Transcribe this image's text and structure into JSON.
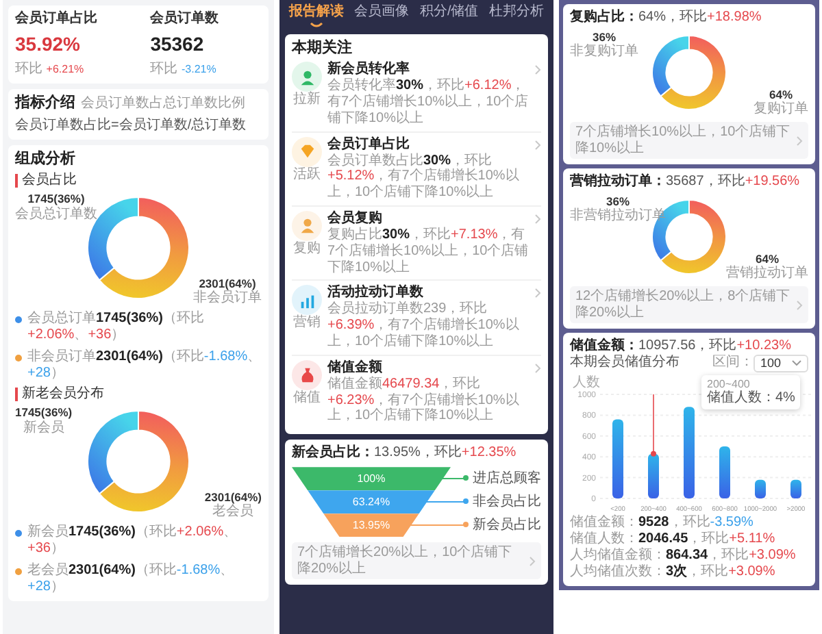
{
  "member_panel": {
    "metrics": [
      {
        "label": "会员订单占比",
        "value": "35.92%",
        "highlight": true,
        "trend_label": "环比",
        "change": {
          "text": "+6.21%",
          "kind": "up"
        }
      },
      {
        "label": "会员订单数",
        "value": "35362",
        "highlight": false,
        "trend_label": "环比",
        "change": {
          "text": "-3.21%",
          "kind": "down"
        }
      }
    ],
    "intro": {
      "title": "指标介绍",
      "subtitle": "会员订单数占总订单数比例",
      "formula": "会员订单数占比=会员订单数/总订单数"
    },
    "composition": {
      "title": "组成分析",
      "sections": [
        {
          "title": "会员占比",
          "chart_data": {
            "type": "donut",
            "categories": [
              "会员总订单数",
              "非会员订单"
            ],
            "values": [
              36,
              64
            ],
            "value_labels": [
              "1745(36%)",
              "2301(64%)"
            ]
          },
          "legend": [
            {
              "color": "#3d8fe8",
              "segments": [
                {
                  "text": "会员总订单",
                  "kind": "muted"
                },
                {
                  "text": "1745(36%)",
                  "kind": "bold"
                },
                {
                  "text": "（环比",
                  "kind": "muted"
                },
                {
                  "text": "+2.06%",
                  "kind": "up"
                },
                {
                  "text": "、",
                  "kind": "muted"
                },
                {
                  "text": "+36",
                  "kind": "up"
                },
                {
                  "text": "）",
                  "kind": "muted"
                }
              ]
            },
            {
              "color": "#f0a040",
              "segments": [
                {
                  "text": "非会员订单",
                  "kind": "muted"
                },
                {
                  "text": "2301(64%)",
                  "kind": "bold"
                },
                {
                  "text": "（环比",
                  "kind": "muted"
                },
                {
                  "text": "-1.68%",
                  "kind": "down"
                },
                {
                  "text": "、",
                  "kind": "muted"
                },
                {
                  "text": "+28",
                  "kind": "down"
                },
                {
                  "text": "）",
                  "kind": "muted"
                }
              ]
            }
          ]
        },
        {
          "title": "新老会员分布",
          "chart_data": {
            "type": "donut",
            "categories": [
              "新会员",
              "老会员"
            ],
            "values": [
              36,
              64
            ],
            "value_labels": [
              "1745(36%)",
              "2301(64%)"
            ]
          },
          "legend": [
            {
              "color": "#3d8fe8",
              "segments": [
                {
                  "text": "新会员",
                  "kind": "muted"
                },
                {
                  "text": "1745(36%)",
                  "kind": "bold"
                },
                {
                  "text": "（环比",
                  "kind": "muted"
                },
                {
                  "text": "+2.06%",
                  "kind": "up"
                },
                {
                  "text": "、",
                  "kind": "muted"
                },
                {
                  "text": "+36",
                  "kind": "up"
                },
                {
                  "text": "）",
                  "kind": "muted"
                }
              ]
            },
            {
              "color": "#f0a040",
              "segments": [
                {
                  "text": "老会员",
                  "kind": "muted"
                },
                {
                  "text": "2301(64%)",
                  "kind": "bold"
                },
                {
                  "text": "（环比",
                  "kind": "muted"
                },
                {
                  "text": "-1.68%",
                  "kind": "down"
                },
                {
                  "text": "、",
                  "kind": "muted"
                },
                {
                  "text": "+28",
                  "kind": "down"
                },
                {
                  "text": "）",
                  "kind": "muted"
                }
              ]
            }
          ]
        }
      ]
    }
  },
  "report_panel": {
    "tabs": [
      {
        "label": "报告解读",
        "selected": true
      },
      {
        "label": "会员画像",
        "selected": false
      },
      {
        "label": "积分/储值",
        "selected": false
      },
      {
        "label": "杜邦分析",
        "selected": false
      }
    ],
    "focus": {
      "title": "本期关注",
      "items": [
        {
          "icon_label": "拉新",
          "color": "#2fb866",
          "title": "新会员转化率",
          "segments": [
            {
              "text": "会员转化率",
              "kind": "muted"
            },
            {
              "text": "30%",
              "kind": "bold"
            },
            {
              "text": "，环比",
              "kind": "muted"
            },
            {
              "text": "+6.12%",
              "kind": "up"
            },
            {
              "text": "，有7个店铺增长10%以上，10个店铺下降10%以上",
              "kind": "muted"
            }
          ]
        },
        {
          "icon_label": "活跃",
          "color": "#f5a524",
          "title": "会员订单占比",
          "segments": [
            {
              "text": "会员订单数占比",
              "kind": "muted"
            },
            {
              "text": "30%",
              "kind": "bold"
            },
            {
              "text": "，环比",
              "kind": "muted"
            },
            {
              "text": "+5.12%",
              "kind": "up"
            },
            {
              "text": "，有7个店铺增长10%以上，10个店铺下降10%以上",
              "kind": "muted"
            }
          ]
        },
        {
          "icon_label": "复购",
          "color": "#f0a848",
          "title": "会员复购",
          "segments": [
            {
              "text": "复购占比",
              "kind": "muted"
            },
            {
              "text": "30%",
              "kind": "bold"
            },
            {
              "text": "，环比",
              "kind": "muted"
            },
            {
              "text": "+7.13%",
              "kind": "up"
            },
            {
              "text": "，有7个店铺增长10%以上，10个店铺下降10%以上",
              "kind": "muted"
            }
          ]
        },
        {
          "icon_label": "营销",
          "color": "#22a8e0",
          "title": "活动拉动订单数",
          "segments": [
            {
              "text": "会员拉动订单数239，环比",
              "kind": "muted"
            },
            {
              "text": "+6.39%",
              "kind": "up"
            },
            {
              "text": "，有7个店铺增长10%以上，10个店铺下降10%以上",
              "kind": "muted"
            }
          ]
        },
        {
          "icon_label": "储值",
          "color": "#e84848",
          "title": "储值金额",
          "segments": [
            {
              "text": "储值金额",
              "kind": "muted"
            },
            {
              "text": "46479.34",
              "kind": "up"
            },
            {
              "text": "，环比",
              "kind": "muted"
            },
            {
              "text": "+6.23%",
              "kind": "up"
            },
            {
              "text": "，有7个店铺增长10%以上，10个店铺下降10%以上",
              "kind": "muted"
            }
          ]
        }
      ]
    },
    "funnel_card": {
      "title": [
        {
          "text": "新会员占比：",
          "kind": "bold"
        },
        {
          "text": "13.95%，环比",
          "kind": "plain"
        },
        {
          "text": "+12.35%",
          "kind": "up"
        }
      ],
      "stages": [
        {
          "value": "100%",
          "label": "进店总顾客",
          "color": "#3cb96a"
        },
        {
          "value": "63.24%",
          "label": "非会员占比",
          "color": "#3ea6ee"
        },
        {
          "value": "13.95%",
          "label": "新会员占比",
          "color": "#f7a25c"
        }
      ],
      "footer": "7个店铺增长20%以上，10个店铺下降20%以上"
    }
  },
  "detail_panel": {
    "donut_cards": [
      {
        "title": [
          {
            "text": "复购占比：",
            "kind": "bold"
          },
          {
            "text": "64%，环比",
            "kind": "plain"
          },
          {
            "text": "+18.98%",
            "kind": "up"
          }
        ],
        "chart_data": {
          "type": "donut",
          "categories": [
            "非复购订单",
            "复购订单"
          ],
          "values": [
            36,
            64
          ],
          "value_labels": [
            "36%",
            "64%"
          ]
        },
        "footer": "7个店铺增长10%以上，10个店铺下降10%以上"
      },
      {
        "title": [
          {
            "text": "营销拉动订单：",
            "kind": "bold"
          },
          {
            "text": "35687，环比",
            "kind": "plain"
          },
          {
            "text": "+19.56%",
            "kind": "up"
          }
        ],
        "chart_data": {
          "type": "donut",
          "categories": [
            "非营销拉动订单",
            "营销拉动订单"
          ],
          "values": [
            36,
            64
          ],
          "value_labels": [
            "36%",
            "64%"
          ]
        },
        "footer": "12个店铺增长20%以上，8个店铺下降20%以上"
      }
    ],
    "stored_value": {
      "title": [
        {
          "text": "储值金额：",
          "kind": "bold"
        },
        {
          "text": "10957.56，环比",
          "kind": "plain"
        },
        {
          "text": "+10.23%",
          "kind": "up"
        }
      ],
      "subtitle": "本期会员储值分布",
      "range_label": "区间：",
      "range_value": "100",
      "chart_data": {
        "type": "bar",
        "ylabel": "人数",
        "categories": [
          "<200",
          "200~400",
          "400~600",
          "600~800",
          "1000~2000",
          ">2000"
        ],
        "values": [
          760,
          430,
          880,
          500,
          180,
          180
        ],
        "ylim": [
          0,
          1000
        ],
        "yticks": [
          0,
          200,
          400,
          600,
          800,
          1000
        ],
        "grid": true
      },
      "tooltip": {
        "title": "200~400",
        "text": "储值人数：4%"
      },
      "stats": [
        [
          {
            "text": "储值金额：",
            "kind": "muted"
          },
          {
            "text": "9528",
            "kind": "bold"
          },
          {
            "text": "，环比",
            "kind": "muted"
          },
          {
            "text": "-3.59%",
            "kind": "down"
          }
        ],
        [
          {
            "text": "储值人数：",
            "kind": "muted"
          },
          {
            "text": "2046.45",
            "kind": "bold"
          },
          {
            "text": "，环比",
            "kind": "muted"
          },
          {
            "text": "+5.11%",
            "kind": "up"
          }
        ],
        [
          {
            "text": "人均储值金额：",
            "kind": "muted"
          },
          {
            "text": "864.34",
            "kind": "bold"
          },
          {
            "text": "，环比",
            "kind": "muted"
          },
          {
            "text": "+3.09%",
            "kind": "up"
          }
        ],
        [
          {
            "text": "人均储值次数：",
            "kind": "muted"
          },
          {
            "text": "3次",
            "kind": "bold"
          },
          {
            "text": "，环比",
            "kind": "muted"
          },
          {
            "text": "+3.09%",
            "kind": "up"
          }
        ]
      ]
    }
  }
}
